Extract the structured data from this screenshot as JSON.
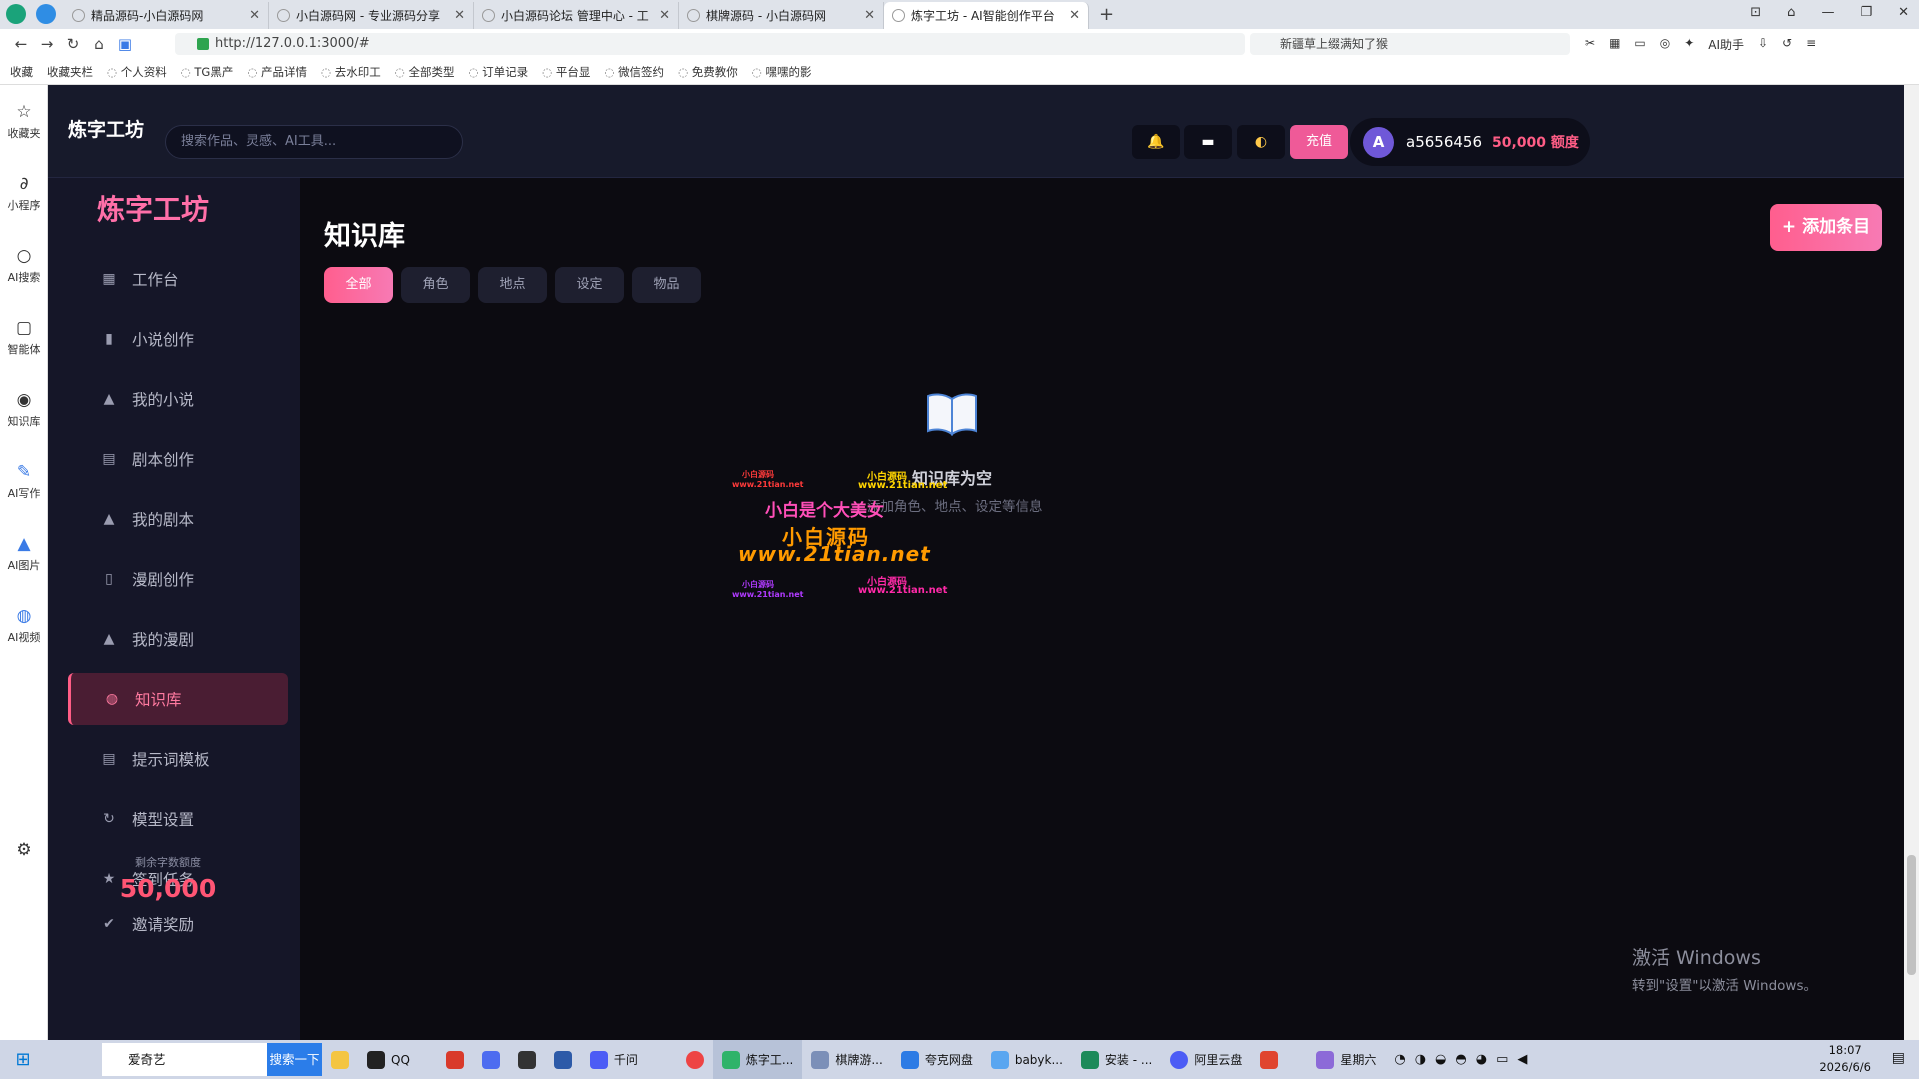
{
  "browser": {
    "tabs": [
      {
        "title": "精品源码-小白源码网"
      },
      {
        "title": "小白源码网 - 专业源码分享"
      },
      {
        "title": "小白源码论坛 管理中心 - 工"
      },
      {
        "title": "棋牌源码 - 小白源码网"
      },
      {
        "title": "炼字工坊 - AI智能创作平台",
        "active": true
      }
    ],
    "url": "http://127.0.0.1:3000/#",
    "search_text": "新疆草上缀满知了猴",
    "ai_helper": "AI助手",
    "bookmarks": [
      "收藏",
      "收藏夹栏",
      "个人资料",
      "TG黑产",
      "产品详情",
      "去水印工",
      "全部类型",
      "订单记录",
      "平台显",
      "微信签约",
      "免费教你",
      "嘿嘿的影"
    ]
  },
  "browser_sidebar": [
    {
      "label": "收藏夹",
      "icon": "star-icon"
    },
    {
      "label": "小程序",
      "icon": "link-icon"
    },
    {
      "label": "AI搜索",
      "icon": "search-icon"
    },
    {
      "label": "智能体",
      "icon": "robot-icon"
    },
    {
      "label": "知识库",
      "icon": "bulb-icon"
    },
    {
      "label": "AI写作",
      "icon": "pen-icon"
    },
    {
      "label": "AI图片",
      "icon": "image-icon"
    },
    {
      "label": "AI视频",
      "icon": "video-icon"
    }
  ],
  "app": {
    "brand": "炼字工坊",
    "search_placeholder": "搜索作品、灵感、AI工具...",
    "recharge": "充值",
    "user": {
      "avatar": "A",
      "name": "a5656456",
      "quota": "50,000 额度"
    },
    "sidebar_brand": "炼字工坊",
    "menu": [
      {
        "label": "工作台",
        "icon": "dashboard-icon"
      },
      {
        "label": "小说创作",
        "icon": "book-icon"
      },
      {
        "label": "我的小说",
        "icon": "person-icon"
      },
      {
        "label": "剧本创作",
        "icon": "script-icon"
      },
      {
        "label": "我的剧本",
        "icon": "person-icon"
      },
      {
        "label": "漫剧创作",
        "icon": "book-open-icon"
      },
      {
        "label": "我的漫剧",
        "icon": "person-icon"
      },
      {
        "label": "知识库",
        "icon": "globe-icon",
        "active": true
      },
      {
        "label": "提示词模板",
        "icon": "template-icon"
      },
      {
        "label": "模型设置",
        "icon": "refresh-icon"
      },
      {
        "label": "签到任务",
        "icon": "star-icon"
      }
    ],
    "quota_label": "剩余字数额度",
    "quota_value": "50,000",
    "invite": "邀请奖励"
  },
  "main": {
    "title": "知识库",
    "add_button": "+ 添加条目",
    "filters": [
      "全部",
      "角色",
      "地点",
      "设定",
      "物品"
    ],
    "active_filter": 0,
    "empty_title": "知识库为空",
    "empty_subtitle": "添加角色、地点、设定等信息"
  },
  "watermark": {
    "line1": "小白是个大美女",
    "line2": "小白源码",
    "line3": "www.21tian.net",
    "small_label": "小白源码",
    "small_url": "www.21tian.net"
  },
  "windows": {
    "activate_title": "激活 Windows",
    "activate_sub": "转到\"设置\"以激活 Windows。"
  },
  "taskbar": {
    "search_text": "爱奇艺",
    "search_btn": "搜索一下",
    "items": [
      "QQ",
      "千问",
      "炼字工...",
      "棋牌游...",
      "夸克网盘",
      "babyk...",
      "安装 - ...",
      "阿里云盘"
    ],
    "weekday": "星期六",
    "time": "18:07",
    "date": "2026/6/6"
  }
}
